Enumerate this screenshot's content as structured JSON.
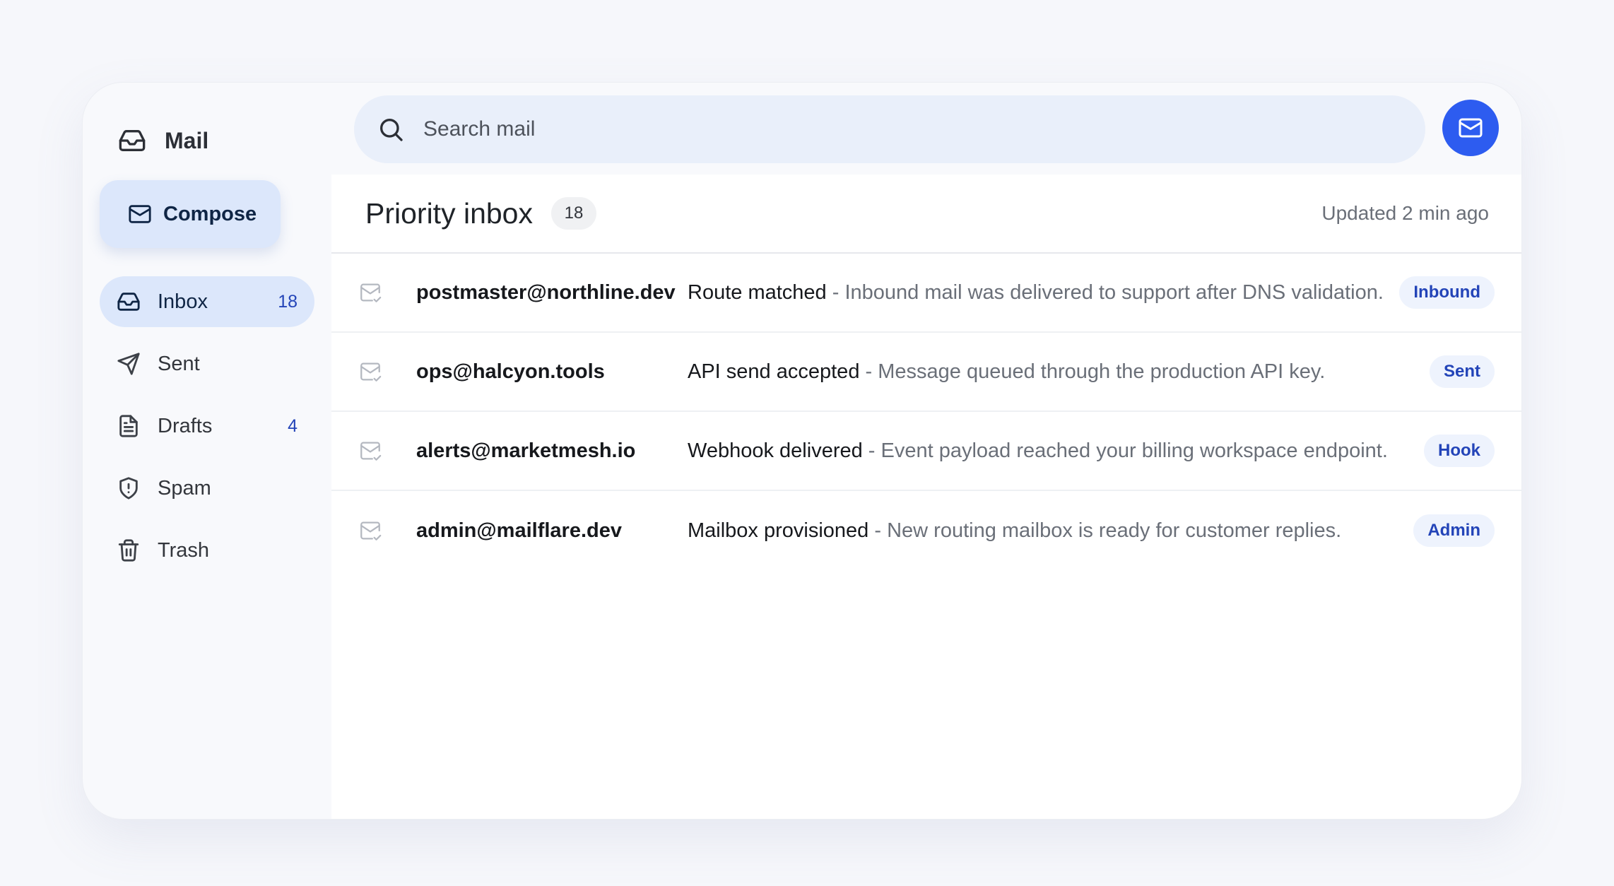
{
  "app": {
    "name": "Mail"
  },
  "search": {
    "placeholder": "Search mail"
  },
  "compose": {
    "label": "Compose"
  },
  "sidebar": {
    "items": [
      {
        "label": "Inbox",
        "count": "18",
        "icon": "inbox-icon",
        "active": true
      },
      {
        "label": "Sent",
        "count": "",
        "icon": "send-icon",
        "active": false
      },
      {
        "label": "Drafts",
        "count": "4",
        "icon": "file-icon",
        "active": false
      },
      {
        "label": "Spam",
        "count": "",
        "icon": "shield-icon",
        "active": false
      },
      {
        "label": "Trash",
        "count": "",
        "icon": "trash-icon",
        "active": false
      }
    ]
  },
  "main": {
    "title": "Priority inbox",
    "count": "18",
    "updated": "Updated 2 min ago",
    "emails": [
      {
        "from": "postmaster@northline.dev",
        "subject": "Route matched",
        "separator": " - ",
        "preview": "Inbound mail was delivered to support after DNS validation.",
        "tag": "Inbound"
      },
      {
        "from": "ops@halcyon.tools",
        "subject": "API send accepted",
        "separator": " - ",
        "preview": "Message queued through the production API key.",
        "tag": "Sent"
      },
      {
        "from": "alerts@marketmesh.io",
        "subject": "Webhook delivered",
        "separator": " - ",
        "preview": "Event payload reached your billing workspace endpoint.",
        "tag": "Hook"
      },
      {
        "from": "admin@mailflare.dev",
        "subject": "Mailbox provisioned",
        "separator": " - ",
        "preview": "New routing mailbox is ready for customer replies.",
        "tag": "Admin"
      }
    ]
  },
  "colors": {
    "accent": "#2d5cf0",
    "active_bg": "#dce7fb",
    "tag_text": "#2344b8",
    "tag_bg": "#eef3fd"
  }
}
